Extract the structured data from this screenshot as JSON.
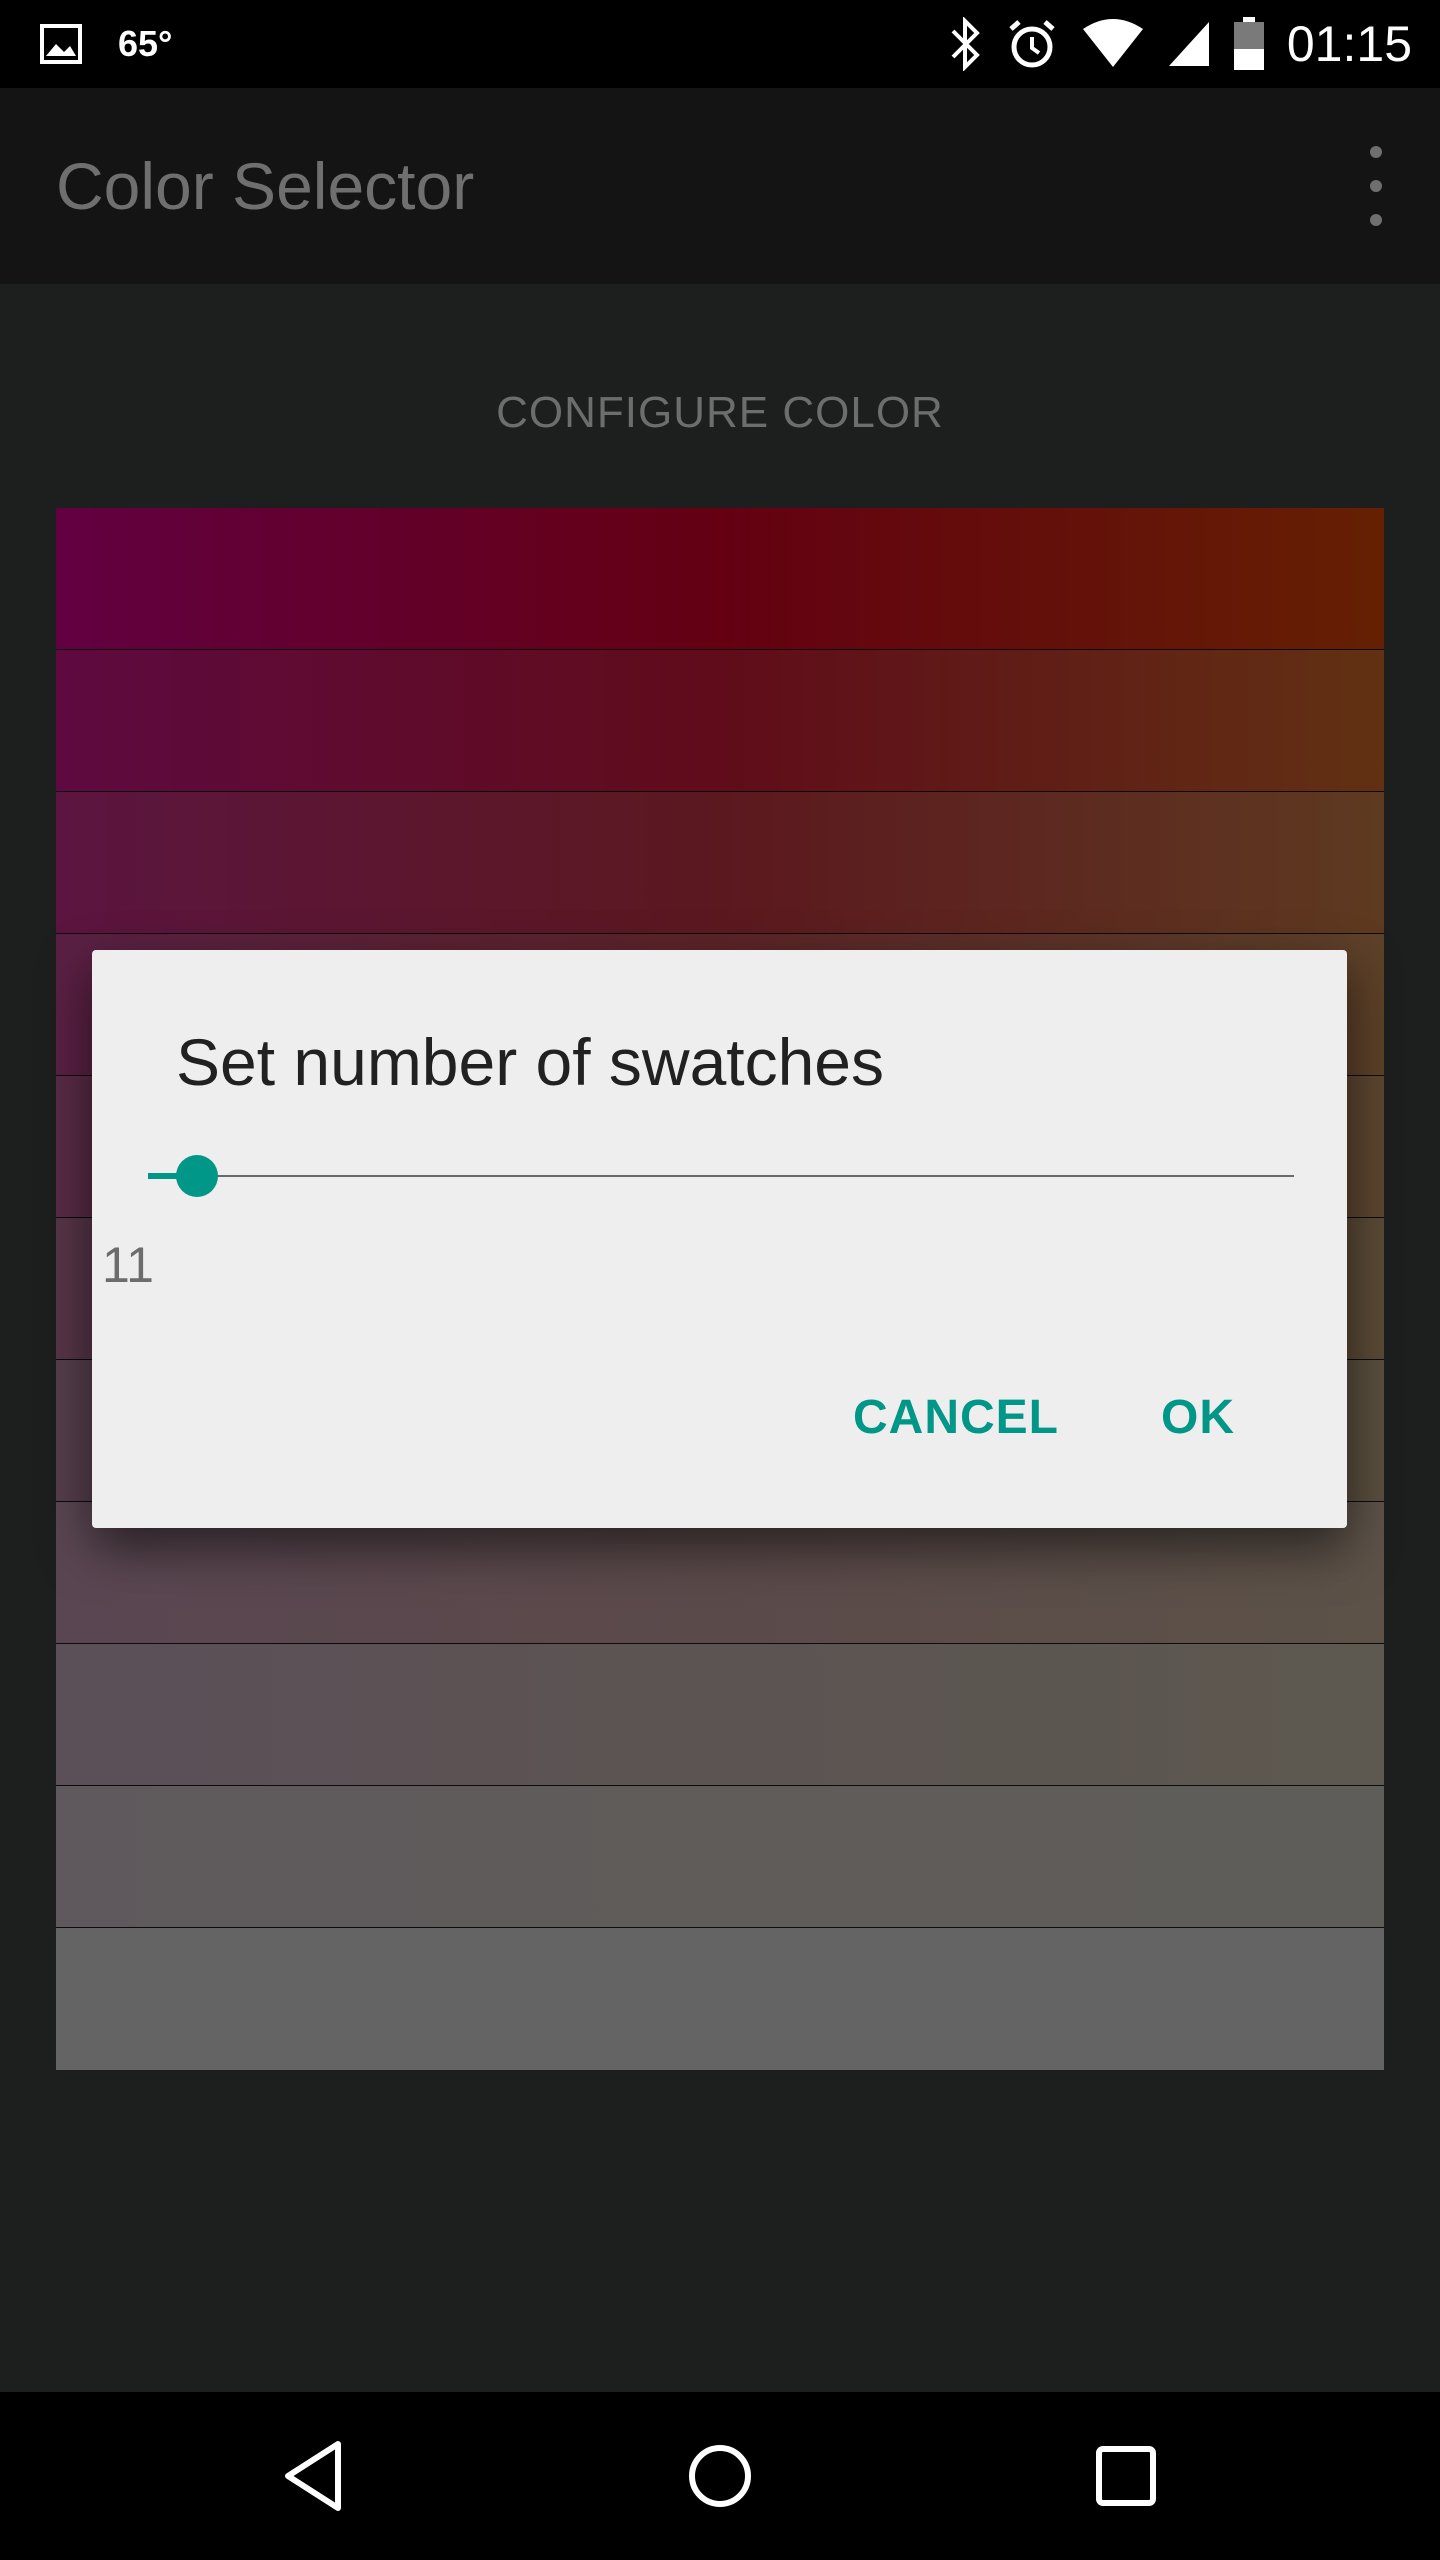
{
  "status_bar": {
    "temperature": "65°",
    "time": "01:15",
    "icons": [
      "image-icon",
      "bluetooth-icon",
      "alarm-icon",
      "wifi-icon",
      "cell-signal-icon",
      "battery-icon"
    ]
  },
  "app_bar": {
    "title": "Color Selector",
    "overflow_icon": "more-vert-icon"
  },
  "main": {
    "configure_label": "CONFIGURE COLOR",
    "swatch_colors": [
      [
        "#620042",
        "#640012",
        "#652002"
      ],
      [
        "#5e0a40",
        "#600c1a",
        "#613112"
      ],
      [
        "#5b1540",
        "#5c181f",
        "#5e3a20"
      ],
      [
        "#5a2044",
        "#5c2428",
        "#5d4128"
      ],
      [
        "#582b46",
        "#5a2e30",
        "#5c4630"
      ],
      [
        "#563548",
        "#583836",
        "#5a4a36"
      ],
      [
        "#553e4c",
        "#57413e",
        "#594e3e"
      ],
      [
        "#5a4652",
        "#5b4a4a",
        "#5c5248"
      ],
      [
        "#5b4f58",
        "#5c5452",
        "#5d5850"
      ],
      [
        "#5f595d",
        "#5f5c5a",
        "#5f5d5a"
      ],
      [
        "#646464",
        "#646464",
        "#646464"
      ]
    ]
  },
  "dialog": {
    "title": "Set number of swatches",
    "slider_value": "11",
    "cancel_label": "CANCEL",
    "ok_label": "OK",
    "accent_color": "#009688"
  },
  "nav_bar": {
    "icons": [
      "back-icon",
      "home-icon",
      "recents-icon"
    ]
  }
}
